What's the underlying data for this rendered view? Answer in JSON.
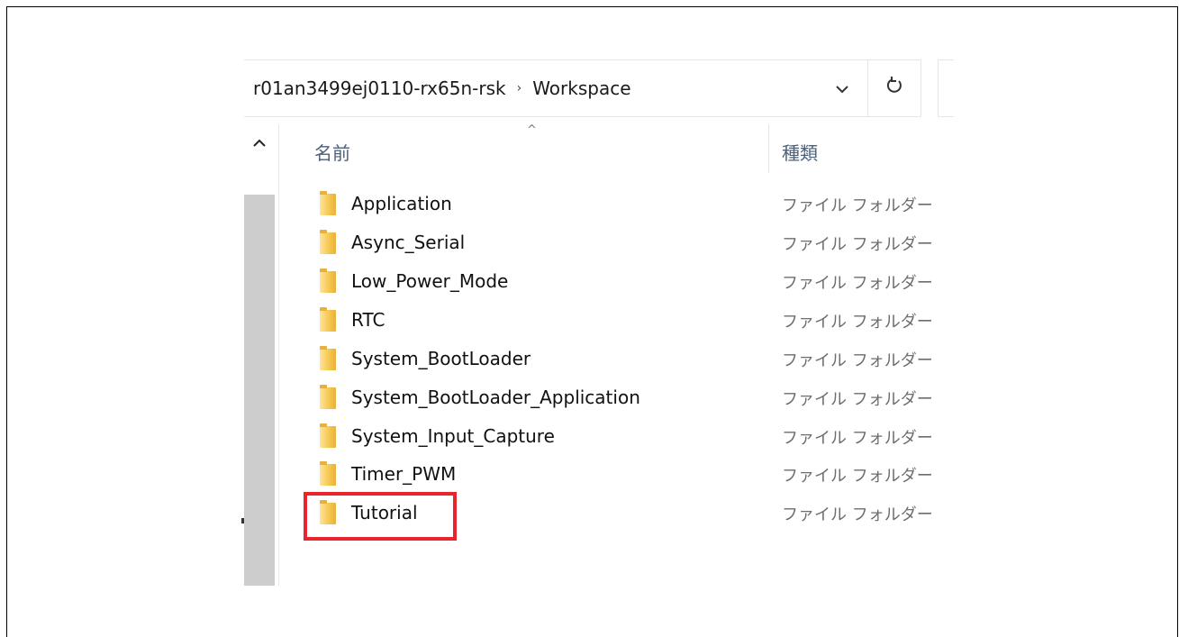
{
  "address_bar": {
    "breadcrumbs": [
      "r01an3499ej0110-rx65n-rsk",
      "Workspace"
    ],
    "separator": "›",
    "dropdown_icon": "chevron-down-icon",
    "refresh_icon": "refresh-icon"
  },
  "file_list": {
    "sort_indicator": "^",
    "columns": {
      "name": "名前",
      "type": "種類"
    },
    "items": [
      {
        "name": "Application",
        "type": "ファイル フォルダー"
      },
      {
        "name": "Async_Serial",
        "type": "ファイル フォルダー"
      },
      {
        "name": "Low_Power_Mode",
        "type": "ファイル フォルダー"
      },
      {
        "name": "RTC",
        "type": "ファイル フォルダー"
      },
      {
        "name": "System_BootLoader",
        "type": "ファイル フォルダー"
      },
      {
        "name": "System_BootLoader_Application",
        "type": "ファイル フォルダー"
      },
      {
        "name": "System_Input_Capture",
        "type": "ファイル フォルダー"
      },
      {
        "name": "Timer_PWM",
        "type": "ファイル フォルダー"
      },
      {
        "name": "Tutorial",
        "type": "ファイル フォルダー"
      }
    ]
  },
  "annotation": {
    "highlighted_item": "Tutorial",
    "color": "#e8252c"
  }
}
